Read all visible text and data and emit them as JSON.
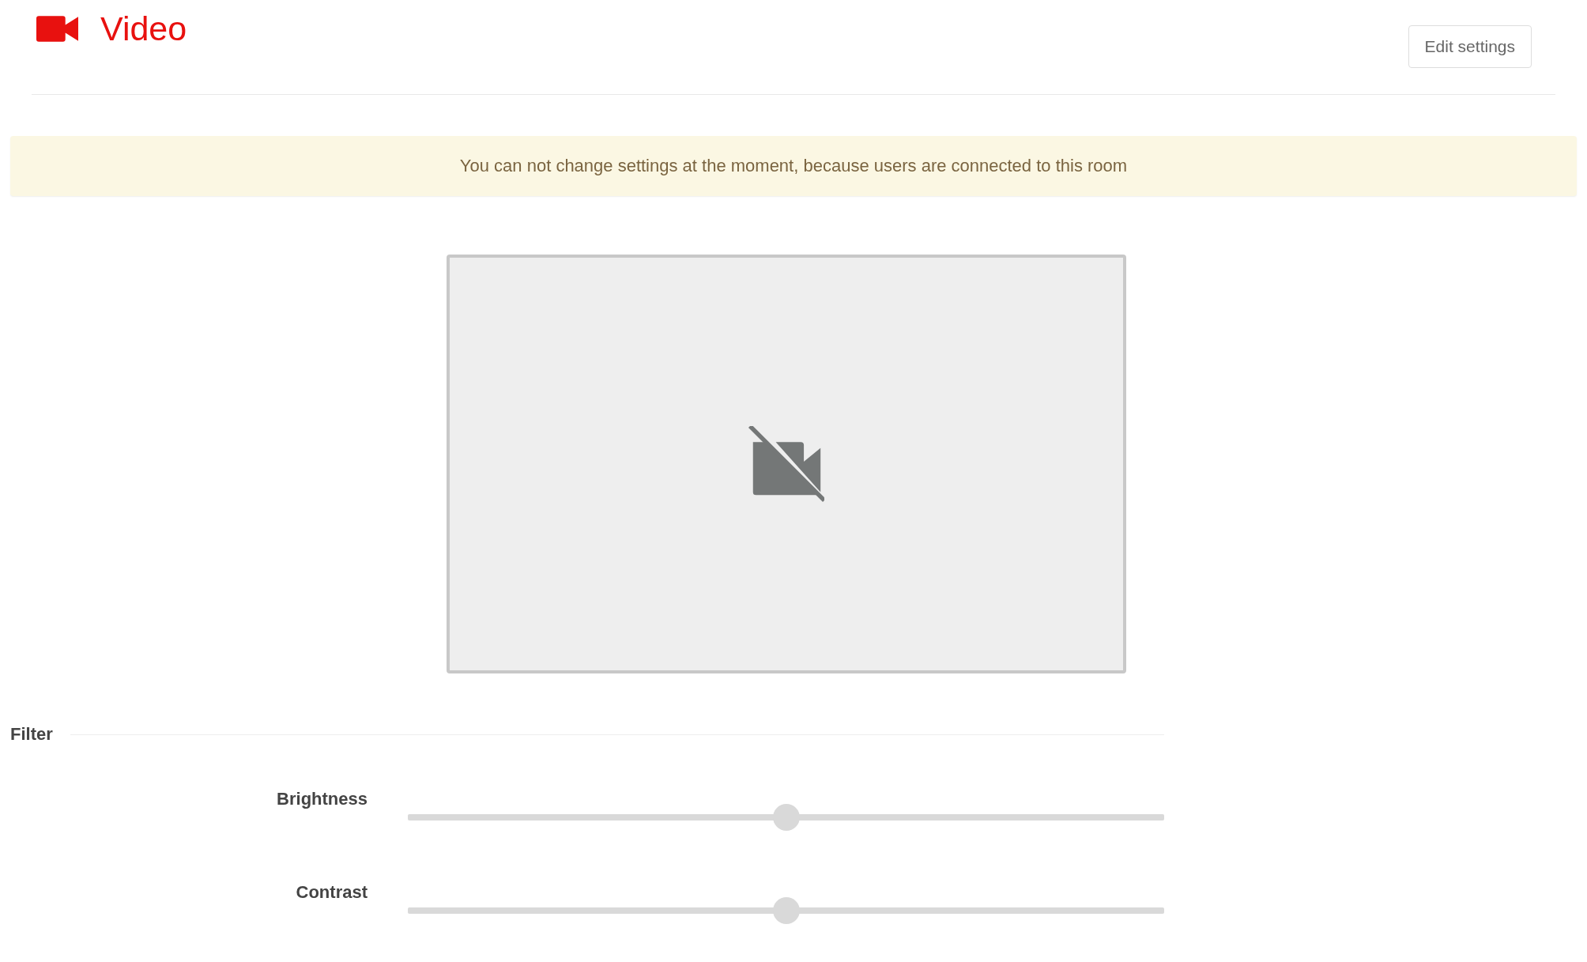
{
  "header": {
    "title": "Video",
    "button": "Edit settings"
  },
  "alert": {
    "text": "You can not change settings at the moment, because users are connected to this room"
  },
  "preview": {
    "camera_off": true
  },
  "filter": {
    "title": "Filter",
    "sliders": [
      {
        "label": "Brightness",
        "level": 0.5
      },
      {
        "label": "Contrast",
        "level": 0.5
      }
    ]
  }
}
